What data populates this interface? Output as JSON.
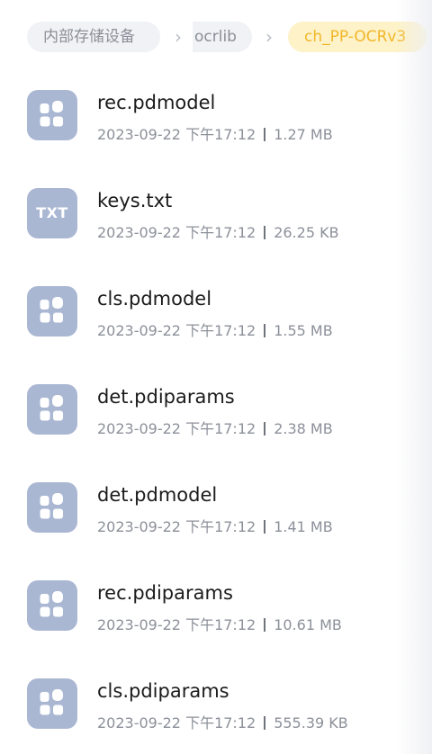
{
  "breadcrumb": {
    "root": "内部存储设备",
    "middle": "ocrlib",
    "current": "ch_PP-OCRv3"
  },
  "files": [
    {
      "name": "rec.pdmodel",
      "date": "2023-09-22 下午17:12",
      "size": "1.27 MB",
      "icon": "grid-file-icon"
    },
    {
      "name": "keys.txt",
      "date": "2023-09-22 下午17:12",
      "size": "26.25 KB",
      "icon": "txt-file-icon",
      "icon_text": "TXT"
    },
    {
      "name": "cls.pdmodel",
      "date": "2023-09-22 下午17:12",
      "size": "1.55 MB",
      "icon": "grid-file-icon"
    },
    {
      "name": "det.pdiparams",
      "date": "2023-09-22 下午17:12",
      "size": "2.38 MB",
      "icon": "grid-file-icon"
    },
    {
      "name": "det.pdmodel",
      "date": "2023-09-22 下午17:12",
      "size": "1.41 MB",
      "icon": "grid-file-icon"
    },
    {
      "name": "rec.pdiparams",
      "date": "2023-09-22 下午17:12",
      "size": "10.61 MB",
      "icon": "grid-file-icon"
    },
    {
      "name": "cls.pdiparams",
      "date": "2023-09-22 下午17:12",
      "size": "555.39 KB",
      "icon": "grid-file-icon"
    }
  ],
  "colors": {
    "icon_bg": "#aab7d3",
    "current_crumb_bg": "#fdf2c8",
    "current_crumb_text": "#f2b72a"
  }
}
